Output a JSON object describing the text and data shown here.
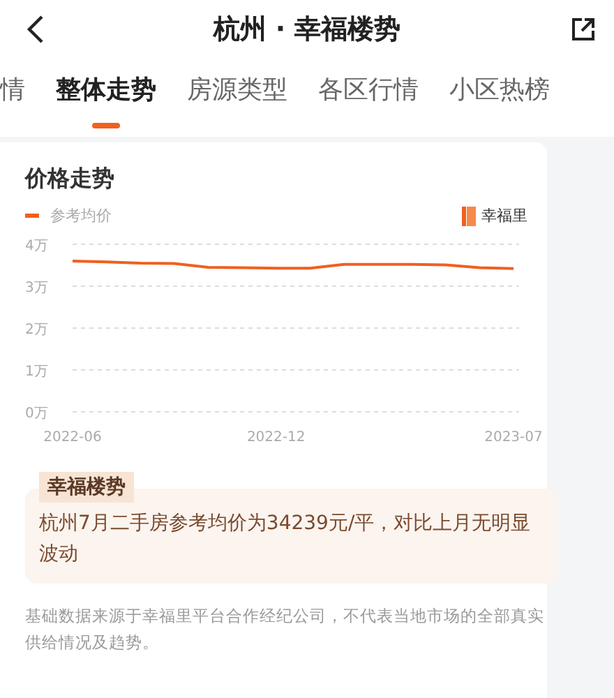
{
  "header": {
    "title": "杭州 · 幸福楼势"
  },
  "tabs": [
    {
      "label": "情",
      "selected": false
    },
    {
      "label": "整体走势",
      "selected": true
    },
    {
      "label": "房源类型",
      "selected": false
    },
    {
      "label": "各区行情",
      "selected": false
    },
    {
      "label": "小区热榜",
      "selected": false
    }
  ],
  "price_card": {
    "title": "价格走势",
    "brand": "幸福里",
    "chart_data": {
      "type": "line",
      "categories": [
        "2022-06",
        null,
        null,
        null,
        null,
        null,
        "2022-12",
        null,
        null,
        null,
        null,
        null,
        null,
        "2023-07"
      ],
      "series": [
        {
          "name": "参考均价",
          "color": "#f0601e",
          "values": [
            3.6,
            3.58,
            3.55,
            3.54,
            3.45,
            3.44,
            3.43,
            3.43,
            3.52,
            3.52,
            3.52,
            3.51,
            3.44,
            3.42
          ]
        }
      ],
      "ylim": [
        0,
        4
      ],
      "grid": true,
      "yticks": [
        {
          "value": 0,
          "label": "0万"
        },
        {
          "value": 1,
          "label": "1万"
        },
        {
          "value": 2,
          "label": "2万"
        },
        {
          "value": 3,
          "label": "3万"
        },
        {
          "value": 4,
          "label": "4万"
        }
      ]
    },
    "summary": {
      "tag": "幸福楼势",
      "text": "杭州7月二手房参考均价为34239元/平，对比上月无明显波动"
    },
    "footnote": "基础数据来源于幸福里平台合作经纪公司，不代表当地市场的全部真实供给情况及趋势。"
  }
}
